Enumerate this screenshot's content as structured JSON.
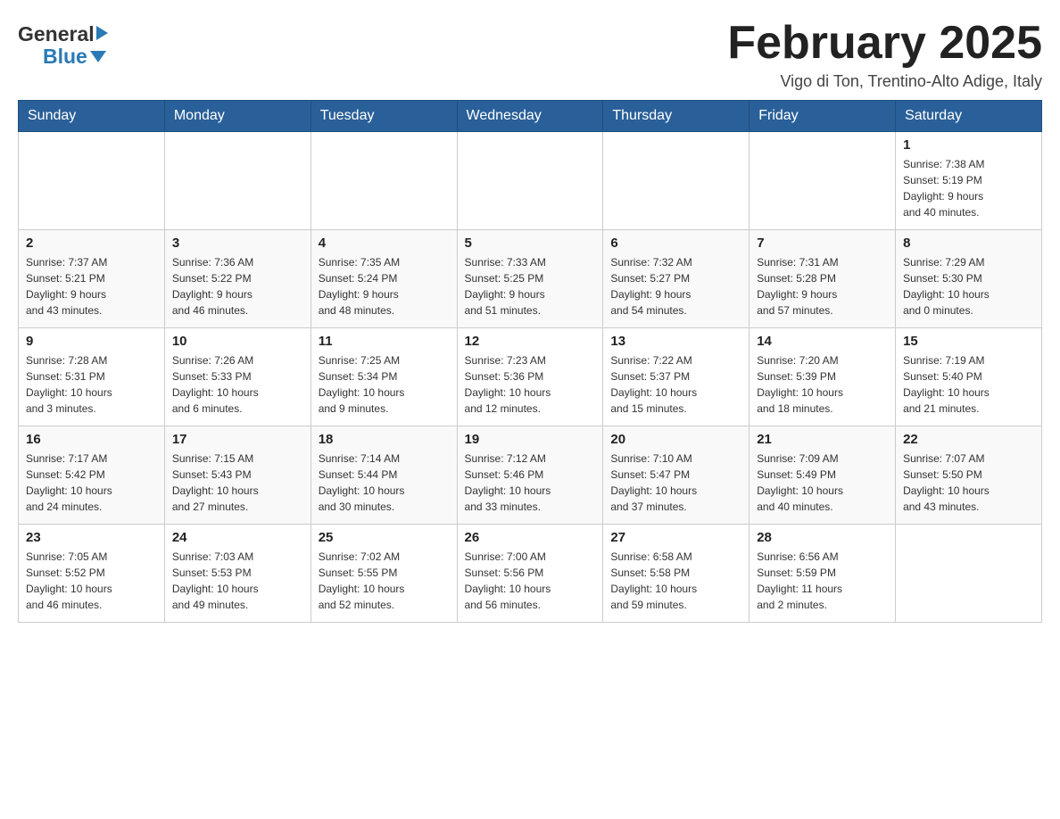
{
  "header": {
    "logo_general": "General",
    "logo_blue": "Blue",
    "title": "February 2025",
    "location": "Vigo di Ton, Trentino-Alto Adige, Italy"
  },
  "days_of_week": [
    "Sunday",
    "Monday",
    "Tuesday",
    "Wednesday",
    "Thursday",
    "Friday",
    "Saturday"
  ],
  "weeks": [
    {
      "days": [
        {
          "num": "",
          "info": ""
        },
        {
          "num": "",
          "info": ""
        },
        {
          "num": "",
          "info": ""
        },
        {
          "num": "",
          "info": ""
        },
        {
          "num": "",
          "info": ""
        },
        {
          "num": "",
          "info": ""
        },
        {
          "num": "1",
          "info": "Sunrise: 7:38 AM\nSunset: 5:19 PM\nDaylight: 9 hours\nand 40 minutes."
        }
      ]
    },
    {
      "days": [
        {
          "num": "2",
          "info": "Sunrise: 7:37 AM\nSunset: 5:21 PM\nDaylight: 9 hours\nand 43 minutes."
        },
        {
          "num": "3",
          "info": "Sunrise: 7:36 AM\nSunset: 5:22 PM\nDaylight: 9 hours\nand 46 minutes."
        },
        {
          "num": "4",
          "info": "Sunrise: 7:35 AM\nSunset: 5:24 PM\nDaylight: 9 hours\nand 48 minutes."
        },
        {
          "num": "5",
          "info": "Sunrise: 7:33 AM\nSunset: 5:25 PM\nDaylight: 9 hours\nand 51 minutes."
        },
        {
          "num": "6",
          "info": "Sunrise: 7:32 AM\nSunset: 5:27 PM\nDaylight: 9 hours\nand 54 minutes."
        },
        {
          "num": "7",
          "info": "Sunrise: 7:31 AM\nSunset: 5:28 PM\nDaylight: 9 hours\nand 57 minutes."
        },
        {
          "num": "8",
          "info": "Sunrise: 7:29 AM\nSunset: 5:30 PM\nDaylight: 10 hours\nand 0 minutes."
        }
      ]
    },
    {
      "days": [
        {
          "num": "9",
          "info": "Sunrise: 7:28 AM\nSunset: 5:31 PM\nDaylight: 10 hours\nand 3 minutes."
        },
        {
          "num": "10",
          "info": "Sunrise: 7:26 AM\nSunset: 5:33 PM\nDaylight: 10 hours\nand 6 minutes."
        },
        {
          "num": "11",
          "info": "Sunrise: 7:25 AM\nSunset: 5:34 PM\nDaylight: 10 hours\nand 9 minutes."
        },
        {
          "num": "12",
          "info": "Sunrise: 7:23 AM\nSunset: 5:36 PM\nDaylight: 10 hours\nand 12 minutes."
        },
        {
          "num": "13",
          "info": "Sunrise: 7:22 AM\nSunset: 5:37 PM\nDaylight: 10 hours\nand 15 minutes."
        },
        {
          "num": "14",
          "info": "Sunrise: 7:20 AM\nSunset: 5:39 PM\nDaylight: 10 hours\nand 18 minutes."
        },
        {
          "num": "15",
          "info": "Sunrise: 7:19 AM\nSunset: 5:40 PM\nDaylight: 10 hours\nand 21 minutes."
        }
      ]
    },
    {
      "days": [
        {
          "num": "16",
          "info": "Sunrise: 7:17 AM\nSunset: 5:42 PM\nDaylight: 10 hours\nand 24 minutes."
        },
        {
          "num": "17",
          "info": "Sunrise: 7:15 AM\nSunset: 5:43 PM\nDaylight: 10 hours\nand 27 minutes."
        },
        {
          "num": "18",
          "info": "Sunrise: 7:14 AM\nSunset: 5:44 PM\nDaylight: 10 hours\nand 30 minutes."
        },
        {
          "num": "19",
          "info": "Sunrise: 7:12 AM\nSunset: 5:46 PM\nDaylight: 10 hours\nand 33 minutes."
        },
        {
          "num": "20",
          "info": "Sunrise: 7:10 AM\nSunset: 5:47 PM\nDaylight: 10 hours\nand 37 minutes."
        },
        {
          "num": "21",
          "info": "Sunrise: 7:09 AM\nSunset: 5:49 PM\nDaylight: 10 hours\nand 40 minutes."
        },
        {
          "num": "22",
          "info": "Sunrise: 7:07 AM\nSunset: 5:50 PM\nDaylight: 10 hours\nand 43 minutes."
        }
      ]
    },
    {
      "days": [
        {
          "num": "23",
          "info": "Sunrise: 7:05 AM\nSunset: 5:52 PM\nDaylight: 10 hours\nand 46 minutes."
        },
        {
          "num": "24",
          "info": "Sunrise: 7:03 AM\nSunset: 5:53 PM\nDaylight: 10 hours\nand 49 minutes."
        },
        {
          "num": "25",
          "info": "Sunrise: 7:02 AM\nSunset: 5:55 PM\nDaylight: 10 hours\nand 52 minutes."
        },
        {
          "num": "26",
          "info": "Sunrise: 7:00 AM\nSunset: 5:56 PM\nDaylight: 10 hours\nand 56 minutes."
        },
        {
          "num": "27",
          "info": "Sunrise: 6:58 AM\nSunset: 5:58 PM\nDaylight: 10 hours\nand 59 minutes."
        },
        {
          "num": "28",
          "info": "Sunrise: 6:56 AM\nSunset: 5:59 PM\nDaylight: 11 hours\nand 2 minutes."
        },
        {
          "num": "",
          "info": ""
        }
      ]
    }
  ]
}
